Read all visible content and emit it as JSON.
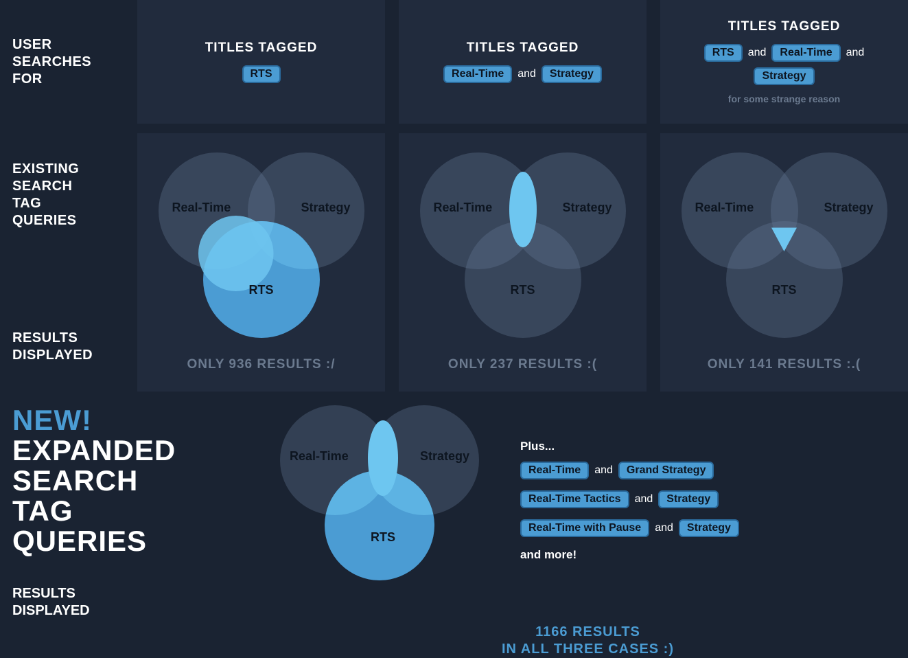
{
  "row1": {
    "sideLabel": "USER\nSEARCHES\nFOR",
    "titlesTagged": "TITLES TAGGED",
    "and": "and",
    "col1": {
      "tags": [
        "RTS"
      ]
    },
    "col2": {
      "tags": [
        "Real-Time",
        "Strategy"
      ]
    },
    "col3": {
      "tags": [
        "RTS",
        "Real-Time",
        "Strategy"
      ],
      "note": "for some strange reason"
    }
  },
  "row2": {
    "sideTop": "EXISTING\nSEARCH\nTAG\nQUERIES",
    "sideBot": "RESULTS\nDISPLAYED",
    "labels": {
      "left": "Real-Time",
      "right": "Strategy",
      "bottom": "RTS"
    },
    "col1Result": "ONLY 936 RESULTS :/",
    "col2Result": "ONLY 237 RESULTS :(",
    "col3Result": "ONLY 141 RESULTS :.("
  },
  "bottom": {
    "new": "NEW!",
    "rest": "EXPANDED\nSEARCH\nTAG\nQUERIES",
    "resultsLabel": "RESULTS\nDISPLAYED",
    "labels": {
      "left": "Real-Time",
      "right": "Strategy",
      "bottom": "RTS"
    },
    "plusHeading": "Plus...",
    "and": "and",
    "plusRows": [
      [
        "Real-Time",
        "Grand Strategy"
      ],
      [
        "Real-Time Tactics",
        "Strategy"
      ],
      [
        "Real-Time with Pause",
        "Strategy"
      ]
    ],
    "more": "and more!",
    "bigResult1": "1166 RESULTS",
    "bigResult2": "IN ALL THREE CASES :)"
  },
  "chart_data": [
    {
      "type": "venn",
      "name": "existing-rts-only",
      "sets": [
        "Real-Time",
        "Strategy",
        "RTS"
      ],
      "highlight": "RTS",
      "result_count": 936
    },
    {
      "type": "venn",
      "name": "existing-rt-and-strategy",
      "sets": [
        "Real-Time",
        "Strategy",
        "RTS"
      ],
      "highlight": "Real-Time ∩ Strategy",
      "result_count": 237
    },
    {
      "type": "venn",
      "name": "existing-all-three",
      "sets": [
        "Real-Time",
        "Strategy",
        "RTS"
      ],
      "highlight": "Real-Time ∩ Strategy ∩ RTS",
      "result_count": 141
    },
    {
      "type": "venn",
      "name": "expanded",
      "sets": [
        "Real-Time",
        "Strategy",
        "RTS"
      ],
      "highlight": "union-of-pairwise-intersections",
      "result_count": 1166
    }
  ]
}
